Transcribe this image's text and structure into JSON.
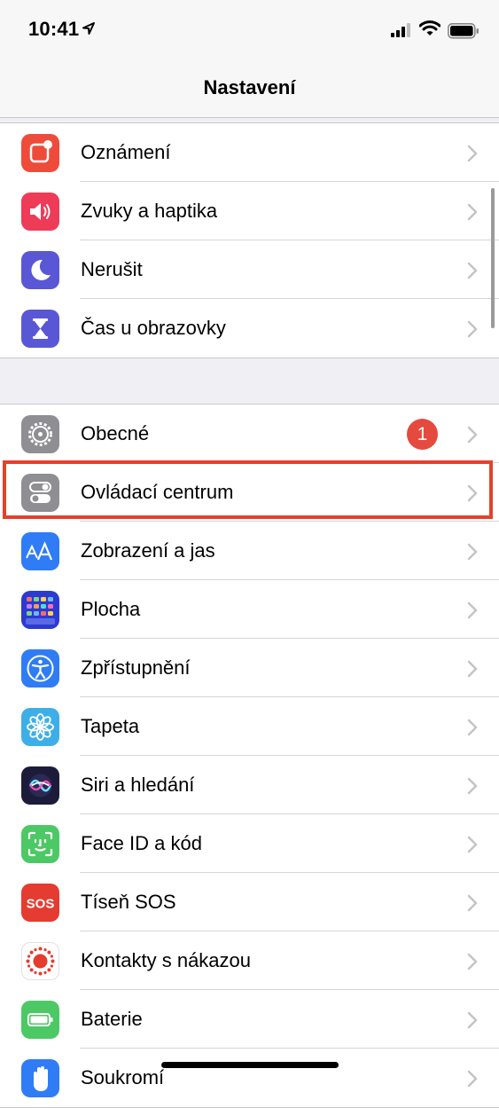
{
  "status_bar": {
    "time": "10:41"
  },
  "nav": {
    "title": "Nastavení"
  },
  "groups": [
    {
      "items": [
        {
          "label": "Oznámení",
          "icon": "notifications-icon",
          "icon_color": "#ef4b3a"
        },
        {
          "label": "Zvuky a haptika",
          "icon": "sound-icon",
          "icon_color": "#ee3b58"
        },
        {
          "label": "Nerušit",
          "icon": "moon-icon",
          "icon_color": "#5a57d6"
        },
        {
          "label": "Čas u obrazovky",
          "icon": "hourglass-icon",
          "icon_color": "#5a57d6"
        }
      ]
    },
    {
      "items": [
        {
          "label": "Obecné",
          "icon": "gear-icon",
          "icon_color": "#8e8e93",
          "badge": "1"
        },
        {
          "label": "Ovládací centrum",
          "icon": "toggles-icon",
          "icon_color": "#8e8e93",
          "highlighted": true
        },
        {
          "label": "Zobrazení a jas",
          "icon": "text-size-icon",
          "icon_color": "#2f7cf6"
        },
        {
          "label": "Plocha",
          "icon": "home-grid-icon",
          "icon_color": "#2c3ad1"
        },
        {
          "label": "Zpřístupnění",
          "icon": "accessibility-icon",
          "icon_color": "#2f7cf6"
        },
        {
          "label": "Tapeta",
          "icon": "flower-icon",
          "icon_color": "#3eaee8"
        },
        {
          "label": "Siri a hledání",
          "icon": "siri-icon",
          "icon_color": "#1c1c3a"
        },
        {
          "label": "Face ID a kód",
          "icon": "faceid-icon",
          "icon_color": "#4cc964"
        },
        {
          "label": "Tíseň SOS",
          "icon": "sos-icon",
          "icon_color": "#e53b30",
          "icon_text": "SOS"
        },
        {
          "label": "Kontakty s nákazou",
          "icon": "exposure-icon",
          "icon_color": "#e53b30"
        },
        {
          "label": "Baterie",
          "icon": "battery-icon",
          "icon_color": "#4cc964"
        },
        {
          "label": "Soukromí",
          "icon": "hand-icon",
          "icon_color": "#2f7cf6"
        }
      ]
    }
  ]
}
